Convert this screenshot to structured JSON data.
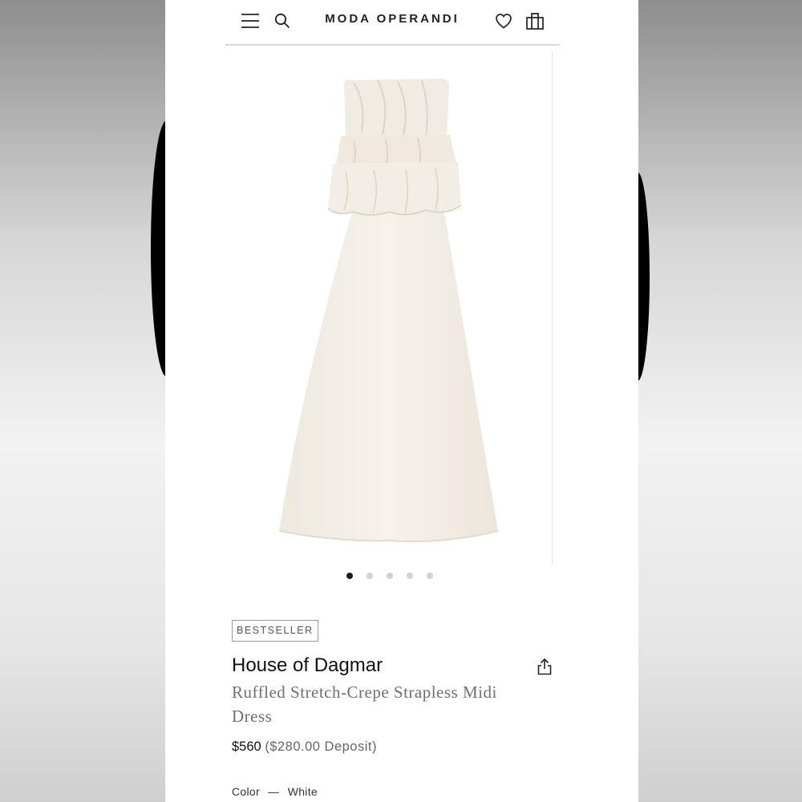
{
  "header": {
    "menu_icon": "hamburger-menu-icon",
    "search_icon": "search-icon",
    "logo": "MODA OPERANDI",
    "wishlist_icon": "heart-icon",
    "bag_icon": "shopping-bag-icon"
  },
  "gallery": {
    "total_images": 5,
    "active_index": 0,
    "product_color": "#f3efe6"
  },
  "product": {
    "badge": "BESTSELLER",
    "brand": "House of Dagmar",
    "name": "Ruffled Stretch-Crepe Strapless Midi Dress",
    "price": "$560",
    "deposit": "($280.00 Deposit)",
    "color_label": "Color",
    "color_separator": "—",
    "color_value": "White",
    "share_icon": "share-icon"
  }
}
